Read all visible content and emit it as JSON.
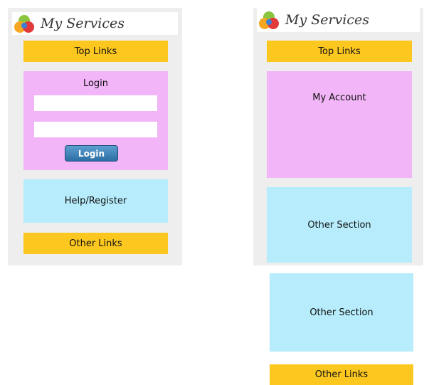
{
  "left_screen": {
    "title": "My Services",
    "top_links": "Top Links",
    "login": {
      "heading": "Login",
      "username_value": "",
      "password_value": "",
      "button_label": "Login"
    },
    "help_register": "Help/Register",
    "other_links": "Other Links"
  },
  "right_screen": {
    "title": "My Services",
    "top_links": "Top Links",
    "my_account": "My Account",
    "other_section_1": "Other Section",
    "other_section_2": "Other Section",
    "other_links": "Other Links"
  },
  "icons": {
    "logo": "services-logo-icon"
  },
  "colors": {
    "yellow": "#fcc820",
    "pink": "#f2b5f7",
    "cyan": "#b6ecfb",
    "button": "#2c6da3"
  }
}
